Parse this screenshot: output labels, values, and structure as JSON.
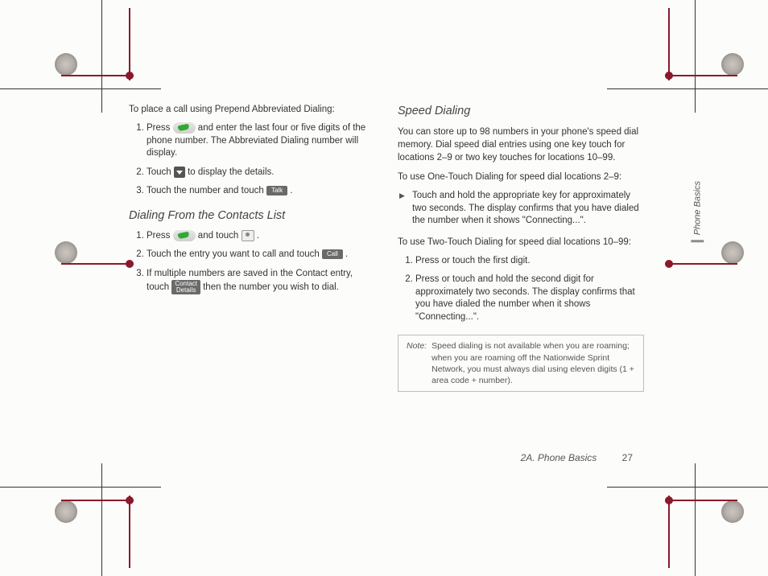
{
  "left": {
    "intro": "To place a call using Prepend Abbreviated Dialing:",
    "steps1": [
      {
        "pre": "Press ",
        "post": " and enter the last four or five digits of the phone number. The Abbreviated Dialing number will display."
      },
      {
        "pre": "Touch ",
        "post": " to display the details."
      },
      {
        "pre": "Touch the number and touch ",
        "label": "Talk",
        "post": "."
      }
    ],
    "heading": "Dialing From the Contacts List",
    "steps2": [
      {
        "pre": "Press ",
        "post": " and touch ",
        "post2": "."
      },
      {
        "pre": "Touch the entry you want to call and touch ",
        "label": "Call",
        "post": "."
      },
      {
        "pre": "If multiple numbers are saved in the Contact entry, touch ",
        "label": "Contact\nDetails",
        "post": " then the number you wish to dial."
      }
    ]
  },
  "right": {
    "heading": "Speed Dialing",
    "intro": "You can store up to 98 numbers in your phone's speed dial memory. Dial speed dial entries using one key touch for locations 2–9 or two key touches for locations 10–99.",
    "sub1": "To use One-Touch Dialing for speed dial locations 2–9:",
    "bullet1": "Touch and hold the appropriate key for approximately two seconds. The display confirms that you have dialed the number when it shows \"Connecting...\".",
    "sub2": "To use Two-Touch Dialing for speed dial locations 10–99:",
    "steps": [
      "Press or touch the first digit.",
      "Press or touch and hold the second digit for approximately two seconds. The display confirms that you have dialed the number when it shows \"Connecting...\"."
    ],
    "note_label": "Note:",
    "note": "Speed dialing is not available when you are roaming; when you are roaming off the Nationwide Sprint Network, you must always dial using eleven digits (1 + area code + number)."
  },
  "footer": {
    "section": "2A. Phone Basics",
    "page": "27"
  },
  "side_tab": "Phone Basics"
}
